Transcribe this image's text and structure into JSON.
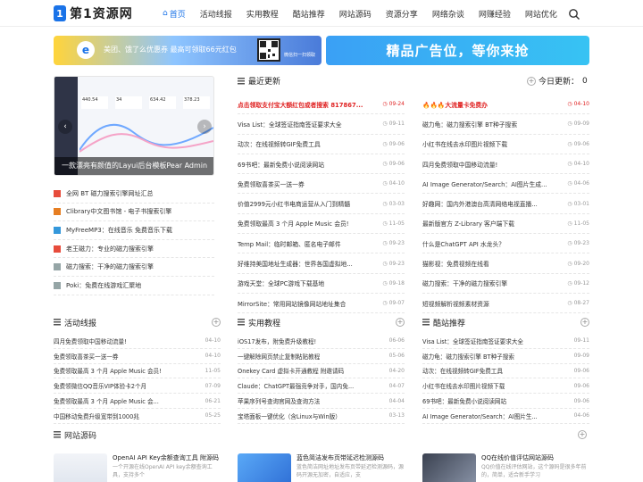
{
  "logo": {
    "badge": "1",
    "text": "第1资源网"
  },
  "nav": [
    {
      "label": "首页",
      "active": true
    },
    {
      "label": "活动线报"
    },
    {
      "label": "实用教程"
    },
    {
      "label": "酷站推荐"
    },
    {
      "label": "网站源码"
    },
    {
      "label": "资源分享"
    },
    {
      "label": "网络杂谈"
    },
    {
      "label": "网赚经验"
    },
    {
      "label": "网站优化"
    }
  ],
  "ad_left": {
    "logo": "e",
    "text": "美团、饿了么优惠券 最高可领取66元红包",
    "qr_caption": "微信扫一扫领取"
  },
  "ad_right": {
    "text": "精品广告位，等你来抢"
  },
  "slider": {
    "stats": [
      "440.54",
      "34",
      "634.42",
      "378.23"
    ],
    "caption": "一款漂亮有颜值的Layui后台模板Pear Admin",
    "prev": "‹",
    "next": "›"
  },
  "left_list": [
    {
      "label": "全网 BT 磁力搜索引擎网址汇总",
      "color": "#e74c3c"
    },
    {
      "label": "Clibrary中文图书馆 - 电子书搜索引擎",
      "color": "#e67e22"
    },
    {
      "label": "MyFreeMP3：在线音乐 免费音乐下载",
      "color": "#3498db"
    },
    {
      "label": "老王磁力：专业的磁力搜索引擎",
      "color": "#e74c3c"
    },
    {
      "label": "磁力搜索：干净的磁力搜索引擎",
      "color": "#95a5a6"
    },
    {
      "label": "Poki：免费在线游戏汇聚地",
      "color": "#95a5a6"
    }
  ],
  "recent": {
    "title": "最近更新",
    "today_label": "今日更新：",
    "today_count": "0",
    "col1": [
      {
        "title": "点击领取支付宝大额红包或者搜索 817867...",
        "date": "09-24",
        "hot": true
      },
      {
        "title": "Visa List：全球签证指南签证要求大全",
        "date": "09-11"
      },
      {
        "title": "动次：在线视频转GIF免费工具",
        "date": "09-06"
      },
      {
        "title": "69书吧：最新免费小说阅读网站",
        "date": "09-06"
      },
      {
        "title": "免费领取喜茶买一送一券",
        "date": "04-10"
      },
      {
        "title": "价值2999元小红书电商运营从入门到精髓",
        "date": "03-03"
      },
      {
        "title": "免费领取最高 3 个月 Apple Music 会员!",
        "date": "11-05"
      },
      {
        "title": "Temp Mail：临时邮箱、匿名电子邮件",
        "date": "09-23"
      },
      {
        "title": "好维持美国地址生成器：世界各国虚拟地...",
        "date": "09-23"
      },
      {
        "title": "游戏天堂：全球PC游戏下载基地",
        "date": "09-18"
      },
      {
        "title": "MirrorSite：常用网站镜像网站地址集合",
        "date": "09-07"
      }
    ],
    "col2": [
      {
        "title": "🔥🔥🔥大流量卡免费办",
        "date": "04-10",
        "hot": true
      },
      {
        "title": "磁力龟：磁力搜索引擎 BT种子搜索",
        "date": "09-09"
      },
      {
        "title": "小红书在线去水印图片视频下载",
        "date": "09-06"
      },
      {
        "title": "四月免费领取中国移动流量!",
        "date": "04-10"
      },
      {
        "title": "AI Image Generator/Search：AI图片生成...",
        "date": "04-06"
      },
      {
        "title": "好趣网：国内外港澳台高清网络电视直播...",
        "date": "03-01"
      },
      {
        "title": "最新版官方 Z-Library 客户端下载",
        "date": "11-05"
      },
      {
        "title": "什么是ChatGPT API 水龙头？",
        "date": "09-23"
      },
      {
        "title": "猫影视：免费视频在线看",
        "date": "09-20"
      },
      {
        "title": "磁力搜索：干净的磁力搜索引擎",
        "date": "09-12"
      },
      {
        "title": "短视频解析视频素材资源",
        "date": "08-27"
      }
    ]
  },
  "sections": [
    {
      "title": "活动线报",
      "items": [
        {
          "title": "四月免费领取中国移动流量!",
          "date": "04-10"
        },
        {
          "title": "免费领取喜茶买一送一券",
          "date": "04-10"
        },
        {
          "title": "免费领取最高 3 个月 Apple Music 会员!",
          "date": "11-05"
        },
        {
          "title": "免费领微信QQ音乐VIP体验卡2个月",
          "date": "07-09"
        },
        {
          "title": "免费领取最高 3 个月 Apple Music 会...",
          "date": "06-21"
        },
        {
          "title": "中国移动免费升级宽带到1000兆",
          "date": "05-25"
        }
      ]
    },
    {
      "title": "实用教程",
      "items": [
        {
          "title": "iOS17发布，附免费升级教程!",
          "date": "06-06"
        },
        {
          "title": "一键解除网页禁止复制粘贴教程",
          "date": "05-06"
        },
        {
          "title": "Onekey Card 虚拟卡开通教程 附邀请码",
          "date": "04-20"
        },
        {
          "title": "Claude：ChatGPT最强竞争对手，国内免...",
          "date": "04-07"
        },
        {
          "title": "苹果序列号查询官网及查询方法",
          "date": "04-04"
        },
        {
          "title": "宝塔面板一键优化（含Linux与Win版）",
          "date": "03-13"
        }
      ]
    },
    {
      "title": "酷站推荐",
      "items": [
        {
          "title": "Visa List：全球签证指南签证要求大全",
          "date": "09-11"
        },
        {
          "title": "磁力龟：磁力搜索引擎 BT种子搜索",
          "date": "09-09"
        },
        {
          "title": "动次：在线视频转GIF免费工具",
          "date": "09-06"
        },
        {
          "title": "小红书在线去水印图片视频下载",
          "date": "09-06"
        },
        {
          "title": "69书吧：最新免费小说阅读网站",
          "date": "09-06"
        },
        {
          "title": "AI Image Generator/Search：AI图片生...",
          "date": "04-06"
        }
      ]
    }
  ],
  "code_section": {
    "title": "网站源码",
    "cards": [
      {
        "title": "OpenAI API Key余额查询工具 附源码",
        "desc": "一个开源在线OpenAI API key余额查询工具，支持多个"
      },
      {
        "title": "蓝色简洁发布页带延迟检测源码",
        "desc": "蓝色简洁网址地址发布页带延迟检测源码，源码开源无加密，自适应，支"
      },
      {
        "title": "QQ在线价值评估网站源码",
        "desc": "QQ价值在线评估网站，这个源码是很多年前的，简单，适合新手学习"
      }
    ]
  },
  "colors": {
    "accent": "#1a73e8",
    "hot": "#e02424"
  }
}
